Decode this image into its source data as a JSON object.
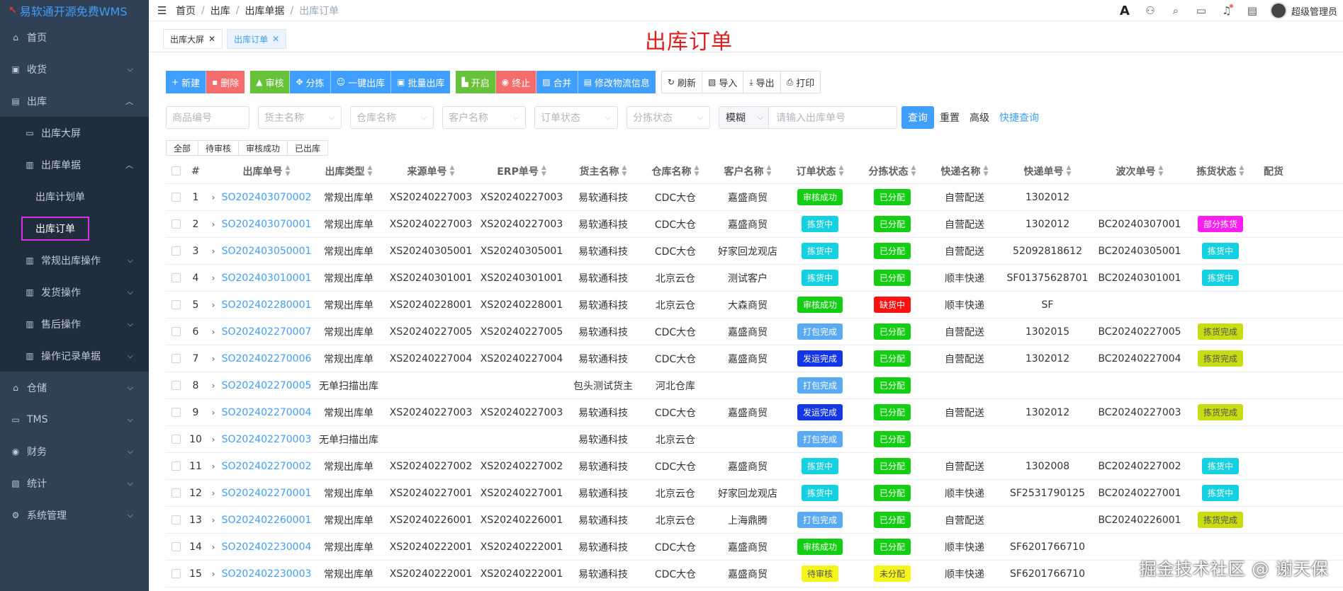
{
  "app": {
    "logo_text": "易软通开源免费WMS"
  },
  "sidebar": {
    "home": "首页",
    "receiving": "收货",
    "outbound": "出库",
    "outbound_dashboard": "出库大屏",
    "outbound_docs": "出库单据",
    "outbound_plan": "出库计划单",
    "outbound_order": "出库订单",
    "regular_ops": "常规出库操作",
    "shipping_ops": "发货操作",
    "aftersales_ops": "售后操作",
    "operation_logs": "操作记录单据",
    "storage": "仓储",
    "tms": "TMS",
    "finance": "财务",
    "statistics": "统计",
    "system": "系统管理"
  },
  "navbar": {
    "breadcrumb": [
      "首页",
      "出库",
      "出库单据",
      "出库订单"
    ],
    "font_icon_text": "A",
    "user_name": "超级管理员"
  },
  "tags": {
    "tab1": "出库大屏",
    "tab2": "出库订单",
    "close": "✕"
  },
  "page_title": "出库订单",
  "toolbar": {
    "new": "新建",
    "delete": "删除",
    "audit": "审核",
    "sort_pick": "分拣",
    "one_click_out": "一键出库",
    "batch_out": "批量出库",
    "open": "开启",
    "terminate": "终止",
    "merge": "合并",
    "edit_logistics": "修改物流信息",
    "refresh": "刷新",
    "import": "导入",
    "export": "导出",
    "print": "打印"
  },
  "filters": {
    "goods_code": "商品编号",
    "owner_name": "货主名称",
    "warehouse_name": "仓库名称",
    "customer_name": "客户名称",
    "order_status": "订单状态",
    "sort_status": "分拣状态",
    "match_mode": "模糊",
    "order_no_placeholder": "请输入出库单号",
    "query": "查询",
    "reset": "重置",
    "advanced": "高级",
    "quick_query": "快捷查询"
  },
  "status_tabs": [
    "全部",
    "待审核",
    "审核成功",
    "已出库"
  ],
  "table": {
    "headers": {
      "index": "#",
      "order_no": "出库单号",
      "type": "出库类型",
      "source_no": "来源单号",
      "erp_no": "ERP单号",
      "owner": "货主名称",
      "warehouse": "仓库名称",
      "customer": "客户名称",
      "order_status": "订单状态",
      "sort_status": "分拣状态",
      "courier": "快递名称",
      "tracking_no": "快递单号",
      "wave_no": "波次单号",
      "pick_status": "拣货状态",
      "dist": "配货"
    },
    "rows": [
      {
        "idx": "1",
        "order_no": "SO202403070002",
        "type": "常规出库单",
        "source_no": "XS20240227003",
        "erp_no": "XS20240227003",
        "owner": "易软通科技",
        "warehouse": "CDC大仓",
        "customer": "嘉盛商贸",
        "order_status": "审核成功",
        "sort_status": "已分配",
        "courier": "自营配送",
        "tracking_no": "1302012",
        "wave_no": "",
        "pick_status": ""
      },
      {
        "idx": "2",
        "order_no": "SO202403070001",
        "type": "常规出库单",
        "source_no": "XS20240227003",
        "erp_no": "XS20240227003",
        "owner": "易软通科技",
        "warehouse": "CDC大仓",
        "customer": "嘉盛商贸",
        "order_status": "拣货中",
        "sort_status": "已分配",
        "courier": "自营配送",
        "tracking_no": "1302012",
        "wave_no": "BC20240307001",
        "pick_status": "部分拣货"
      },
      {
        "idx": "3",
        "order_no": "SO202403050001",
        "type": "常规出库单",
        "source_no": "XS20240305001",
        "erp_no": "XS20240305001",
        "owner": "易软通科技",
        "warehouse": "CDC大仓",
        "customer": "好家回龙观店",
        "order_status": "拣货中",
        "sort_status": "已分配",
        "courier": "自营配送",
        "tracking_no": "52092818612",
        "wave_no": "BC20240305001",
        "pick_status": "拣货中"
      },
      {
        "idx": "4",
        "order_no": "SO202403010001",
        "type": "常规出库单",
        "source_no": "XS20240301001",
        "erp_no": "XS20240301001",
        "owner": "易软通科技",
        "warehouse": "北京云仓",
        "customer": "测试客户",
        "order_status": "拣货中",
        "sort_status": "已分配",
        "courier": "顺丰快递",
        "tracking_no": "SF01375628701",
        "wave_no": "BC20240301001",
        "pick_status": "拣货中"
      },
      {
        "idx": "5",
        "order_no": "SO202402280001",
        "type": "常规出库单",
        "source_no": "XS20240228001",
        "erp_no": "XS20240228001",
        "owner": "易软通科技",
        "warehouse": "北京云仓",
        "customer": "大森商贸",
        "order_status": "审核成功",
        "sort_status": "缺货中",
        "courier": "顺丰快递",
        "tracking_no": "SF",
        "wave_no": "",
        "pick_status": ""
      },
      {
        "idx": "6",
        "order_no": "SO202402270007",
        "type": "常规出库单",
        "source_no": "XS20240227005",
        "erp_no": "XS20240227005",
        "owner": "易软通科技",
        "warehouse": "CDC大仓",
        "customer": "嘉盛商贸",
        "order_status": "打包完成",
        "sort_status": "已分配",
        "courier": "自营配送",
        "tracking_no": "1302015",
        "wave_no": "BC20240227005",
        "pick_status": "拣货完成"
      },
      {
        "idx": "7",
        "order_no": "SO202402270006",
        "type": "常规出库单",
        "source_no": "XS20240227004",
        "erp_no": "XS20240227004",
        "owner": "易软通科技",
        "warehouse": "CDC大仓",
        "customer": "嘉盛商贸",
        "order_status": "发运完成",
        "sort_status": "已分配",
        "courier": "自营配送",
        "tracking_no": "1302012",
        "wave_no": "BC20240227004",
        "pick_status": "拣货完成"
      },
      {
        "idx": "8",
        "order_no": "SO202402270005",
        "type": "无单扫描出库",
        "source_no": "",
        "erp_no": "",
        "owner": "包头测试货主",
        "warehouse": "河北仓库",
        "customer": "",
        "order_status": "打包完成",
        "sort_status": "已分配",
        "courier": "",
        "tracking_no": "",
        "wave_no": "",
        "pick_status": ""
      },
      {
        "idx": "9",
        "order_no": "SO202402270004",
        "type": "常规出库单",
        "source_no": "XS20240227003",
        "erp_no": "XS20240227003",
        "owner": "易软通科技",
        "warehouse": "CDC大仓",
        "customer": "嘉盛商贸",
        "order_status": "发运完成",
        "sort_status": "已分配",
        "courier": "自营配送",
        "tracking_no": "1302012",
        "wave_no": "BC20240227003",
        "pick_status": "拣货完成"
      },
      {
        "idx": "10",
        "order_no": "SO202402270003",
        "type": "无单扫描出库",
        "source_no": "",
        "erp_no": "",
        "owner": "易软通科技",
        "warehouse": "北京云仓",
        "customer": "",
        "order_status": "打包完成",
        "sort_status": "已分配",
        "courier": "",
        "tracking_no": "",
        "wave_no": "",
        "pick_status": ""
      },
      {
        "idx": "11",
        "order_no": "SO202402270002",
        "type": "常规出库单",
        "source_no": "XS20240227002",
        "erp_no": "XS20240227002",
        "owner": "易软通科技",
        "warehouse": "CDC大仓",
        "customer": "嘉盛商贸",
        "order_status": "拣货中",
        "sort_status": "已分配",
        "courier": "自营配送",
        "tracking_no": "1302008",
        "wave_no": "BC20240227002",
        "pick_status": "拣货中"
      },
      {
        "idx": "12",
        "order_no": "SO202402270001",
        "type": "常规出库单",
        "source_no": "XS20240227001",
        "erp_no": "XS20240227001",
        "owner": "易软通科技",
        "warehouse": "北京云仓",
        "customer": "好家回龙观店",
        "order_status": "拣货中",
        "sort_status": "已分配",
        "courier": "顺丰快递",
        "tracking_no": "SF2531790125",
        "wave_no": "BC20240227001",
        "pick_status": "拣货中"
      },
      {
        "idx": "13",
        "order_no": "SO202402260001",
        "type": "常规出库单",
        "source_no": "XS20240226001",
        "erp_no": "XS20240226001",
        "owner": "易软通科技",
        "warehouse": "北京云仓",
        "customer": "上海鼎腾",
        "order_status": "打包完成",
        "sort_status": "已分配",
        "courier": "自营配送",
        "tracking_no": "",
        "wave_no": "BC20240226001",
        "pick_status": "拣货完成"
      },
      {
        "idx": "14",
        "order_no": "SO202402230004",
        "type": "常规出库单",
        "source_no": "XS20240222001",
        "erp_no": "XS20240222001",
        "owner": "易软通科技",
        "warehouse": "CDC大仓",
        "customer": "嘉盛商贸",
        "order_status": "审核成功",
        "sort_status": "已分配",
        "courier": "顺丰快递",
        "tracking_no": "SF6201766710",
        "wave_no": "",
        "pick_status": ""
      },
      {
        "idx": "15",
        "order_no": "SO202402230003",
        "type": "常规出库单",
        "source_no": "XS20240222001",
        "erp_no": "XS20240222001",
        "owner": "易软通科技",
        "warehouse": "CDC大仓",
        "customer": "嘉盛商贸",
        "order_status": "待审核",
        "sort_status": "未分配",
        "courier": "顺丰快递",
        "tracking_no": "SF6201766710",
        "wave_no": "",
        "pick_status": ""
      }
    ]
  },
  "badge_colors": {
    "审核成功": {
      "bg": "#13ce13",
      "fg": "#ffffff"
    },
    "已分配": {
      "bg": "#13ce13",
      "fg": "#ffffff"
    },
    "拣货中": {
      "bg": "#13d1e0",
      "fg": "#ffffff"
    },
    "部分拣货": {
      "bg": "#ff1ef2",
      "fg": "#ffffff"
    },
    "缺货中": {
      "bg": "#ff1111",
      "fg": "#ffffff"
    },
    "打包完成": {
      "bg": "#5aa9f5",
      "fg": "#ffffff"
    },
    "发运完成": {
      "bg": "#1236e8",
      "fg": "#ffffff"
    },
    "拣货完成": {
      "bg": "#c9dc12",
      "fg": "#555555"
    },
    "待审核": {
      "bg": "#f5f51a",
      "fg": "#555555"
    },
    "未分配": {
      "bg": "#f5f51a",
      "fg": "#555555"
    }
  },
  "watermark": "掘金技术社区 @ 谢天保"
}
